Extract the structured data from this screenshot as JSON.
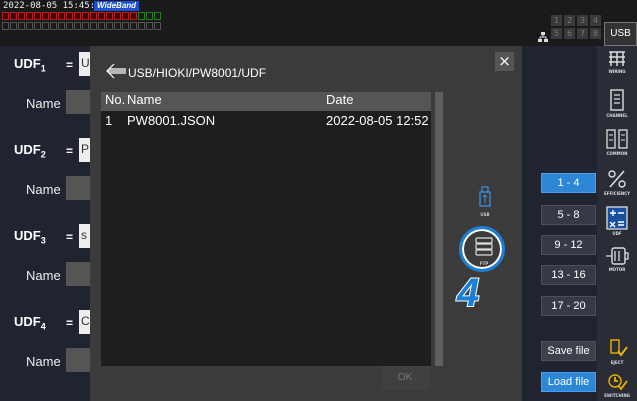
{
  "status": {
    "datetime": "2022-08-05 15:45:11",
    "mode_badge": "WideBand",
    "channel_grid": [
      "1",
      "2",
      "3",
      "4",
      "5",
      "6",
      "7",
      "8"
    ],
    "storage_tab": "USB"
  },
  "udf_rows": [
    {
      "label": "UDF",
      "sub": "1",
      "eq": "=",
      "expr": "U",
      "name_label": "Name"
    },
    {
      "label": "UDF",
      "sub": "2",
      "eq": "=",
      "expr": "P",
      "name_label": "Name"
    },
    {
      "label": "UDF",
      "sub": "3",
      "eq": "=",
      "expr": "s",
      "name_label": "Name"
    },
    {
      "label": "UDF",
      "sub": "4",
      "eq": "=",
      "expr": "C",
      "name_label": "Name"
    }
  ],
  "range_buttons": [
    "1 - 4",
    "5 - 8",
    "9 - 12",
    "13 - 16",
    "17 - 20"
  ],
  "active_range": "1 - 4",
  "file_buttons": {
    "save": "Save file",
    "load": "Load file"
  },
  "sidebar": [
    {
      "icon": "wiring-icon",
      "label": "WIRING"
    },
    {
      "icon": "channel-icon",
      "label": "CHANNEL"
    },
    {
      "icon": "common-icon",
      "label": "COMMON"
    },
    {
      "icon": "efficiency-icon",
      "label": "EFFICIENCY"
    },
    {
      "icon": "udf-icon",
      "label": "UDF"
    },
    {
      "icon": "motor-icon",
      "label": "MOTOR"
    },
    {
      "icon": "eject-icon",
      "label": "EJECT"
    },
    {
      "icon": "switching-icon",
      "label": "SWITCHING"
    }
  ],
  "dialog": {
    "path": "USB/HIOKI/PW8001/UDF",
    "close": "×",
    "columns": {
      "no": "No.",
      "name": "Name",
      "date": "Date"
    },
    "files": [
      {
        "no": "1",
        "name": "PW8001.JSON",
        "date": "2022-08-05 12:52"
      }
    ],
    "ok": "OK",
    "sources": [
      {
        "icon": "usb-icon",
        "label": "USB"
      },
      {
        "icon": "ftp-icon",
        "label": "FTP"
      }
    ],
    "callout": "4"
  },
  "colors": {
    "accent": "#2e86d6",
    "callout": "#1b7fd6",
    "dialog_bg": "#3b3b3b",
    "list_bg": "#1e1e1e"
  }
}
